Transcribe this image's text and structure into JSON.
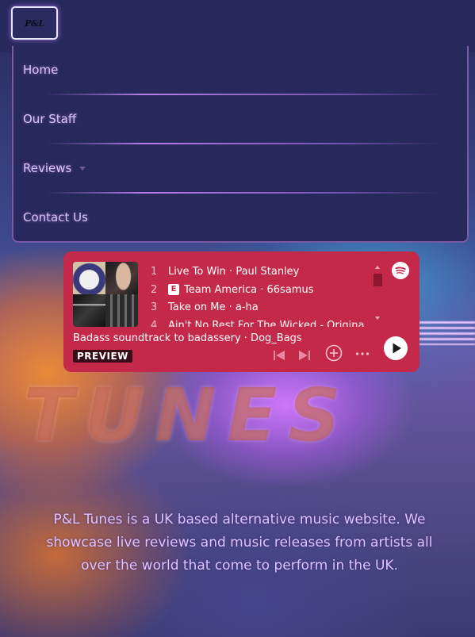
{
  "header": {
    "logo_text": "P&L"
  },
  "nav": {
    "items": [
      {
        "label": "Home"
      },
      {
        "label": "Our Staff"
      },
      {
        "label": "Reviews"
      },
      {
        "label": "Contact Us"
      }
    ]
  },
  "background": {
    "artwork_text": "TUNES"
  },
  "player": {
    "tracks": [
      {
        "number": "1",
        "title": "Live To Win · Paul Stanley",
        "explicit": false
      },
      {
        "number": "2",
        "title": "Team America · 66samus",
        "explicit": true
      },
      {
        "number": "3",
        "title": "Take on Me · a-ha",
        "explicit": false
      },
      {
        "number": "4",
        "title": "Ain't No Rest For The Wicked - Original",
        "explicit": false
      }
    ],
    "explicit_label": "E",
    "playlist_title": "Badass soundtrack to badassery · Dog_Bags",
    "preview_label": "PREVIEW",
    "background_color": "#c5294a",
    "icons": [
      "spotify-icon",
      "previous-icon",
      "next-icon",
      "add-icon",
      "more-icon",
      "play-icon"
    ]
  },
  "description": "P&L Tunes is a UK based alternative music website. We showcase live reviews and music releases from artists all over the world that come to perform in the UK.",
  "colors": {
    "header_bg": "#27285c",
    "nav_text": "#dcc4ff",
    "nav_border": "#7a5aa6"
  }
}
